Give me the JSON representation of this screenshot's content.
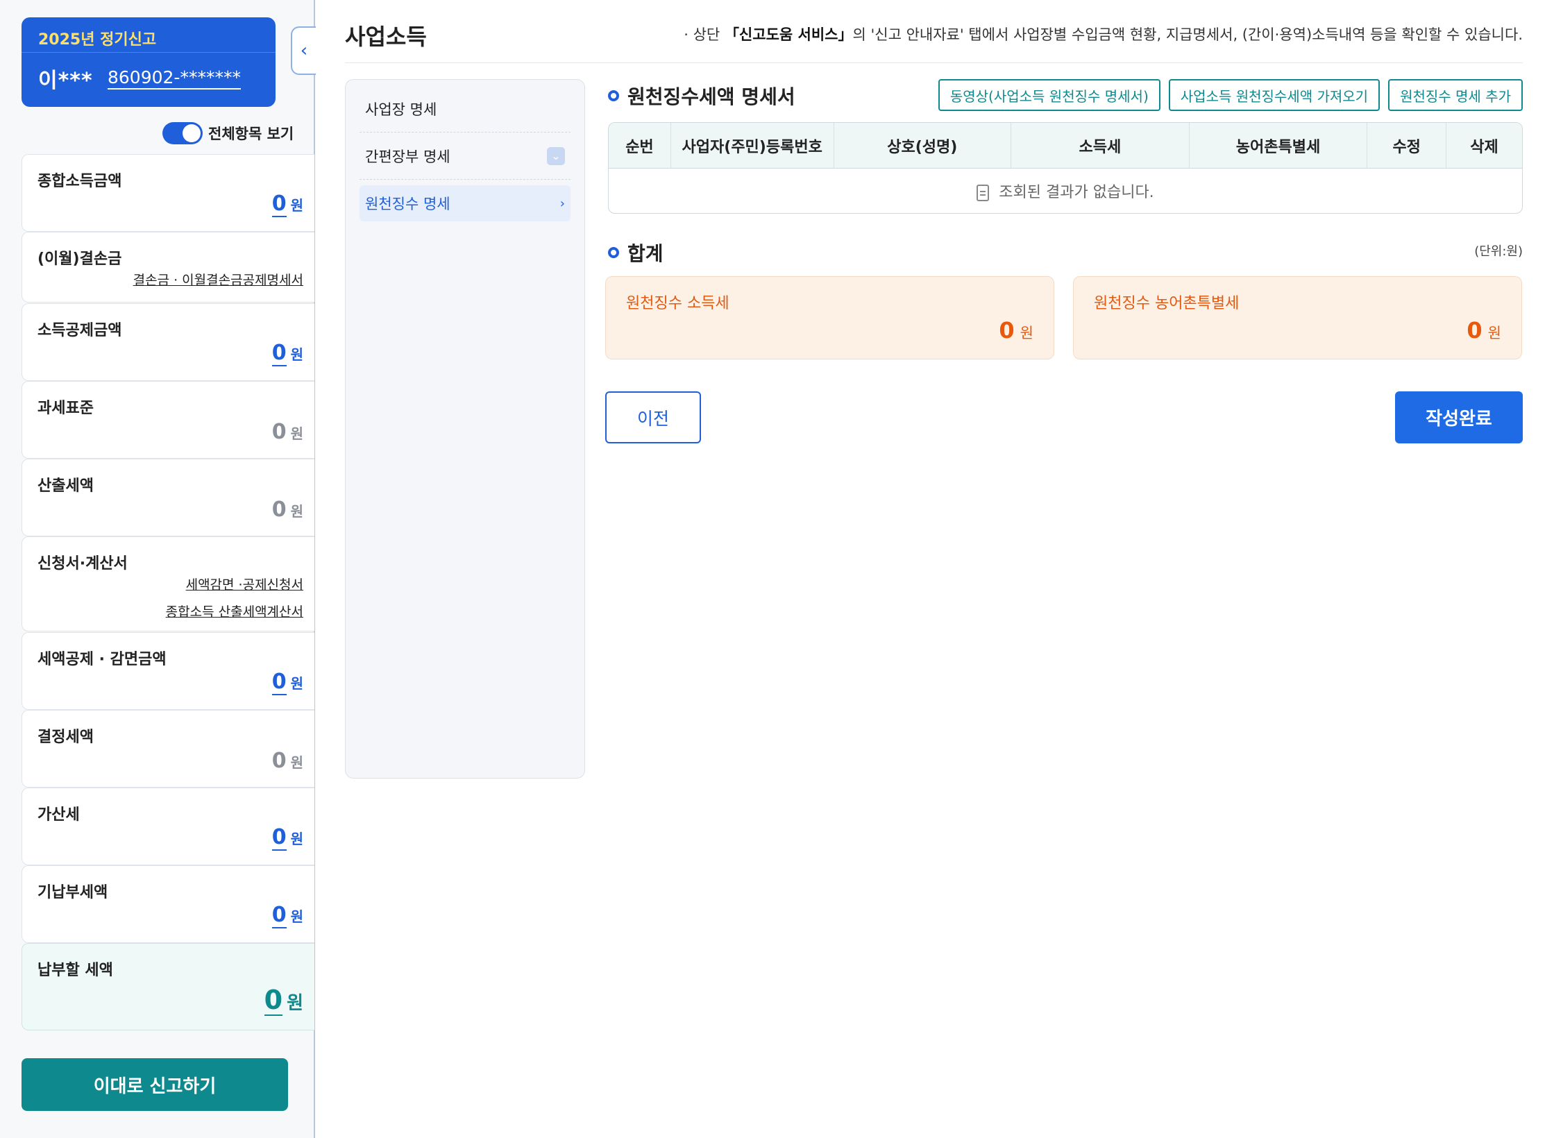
{
  "profile": {
    "year_badge": "2025년 정기신고",
    "name": "이***",
    "rrn": "860902-*******"
  },
  "toggle": {
    "label": "전체항목 보기",
    "on": true
  },
  "summary": {
    "total_income": {
      "label": "종합소득금액",
      "value": "0",
      "unit": "원"
    },
    "carryover_loss": {
      "label": "(이월)결손금",
      "link": "결손금 · 이월결손금공제명세서"
    },
    "income_deduction": {
      "label": "소득공제금액",
      "value": "0",
      "unit": "원"
    },
    "tax_base": {
      "label": "과세표준",
      "value": "0",
      "unit": "원"
    },
    "calculated_tax": {
      "label": "산출세액",
      "value": "0",
      "unit": "원"
    },
    "applications": {
      "label": "신청서·계산서",
      "link1": "세액감면 ·공제신청서",
      "link2": "종합소득 산출세액계산서"
    },
    "tax_credit": {
      "label": "세액공제 · 감면금액",
      "value": "0",
      "unit": "원"
    },
    "determined_tax": {
      "label": "결정세액",
      "value": "0",
      "unit": "원"
    },
    "penalty_tax": {
      "label": "가산세",
      "value": "0",
      "unit": "원"
    },
    "prepaid_tax": {
      "label": "기납부세액",
      "value": "0",
      "unit": "원"
    },
    "payable_tax": {
      "label": "납부할 세액",
      "value": "0",
      "unit": "원"
    }
  },
  "submit_button": "이대로 신고하기",
  "main": {
    "title": "사업소득",
    "notice_prefix": "상단 ",
    "notice_bold": "「신고도움 서비스」",
    "notice_suffix": "의 '신고 안내자료' 탭에서 사업장별 수입금액 현황, 지급명세서, (간이·용역)소득내역 등을 확인할 수 있습니다."
  },
  "submenu": [
    {
      "label": "사업장 명세"
    },
    {
      "label": "간편장부 명세"
    },
    {
      "label": "원천징수 명세"
    }
  ],
  "withholding": {
    "title": "원천징수세액 명세서",
    "buttons": [
      "동영상(사업소득 원천징수 명세서)",
      "사업소득 원천징수세액 가져오기",
      "원천징수 명세 추가"
    ],
    "columns": [
      "순번",
      "사업자(주민)등록번호",
      "상호(성명)",
      "소득세",
      "농어촌특별세",
      "수정",
      "삭제"
    ],
    "empty_message": "조회된 결과가 없습니다."
  },
  "totals": {
    "title": "합계",
    "unit_note": "(단위:원)",
    "income_tax": {
      "label": "원천징수 소득세",
      "value": "0",
      "unit": "원"
    },
    "rural_tax": {
      "label": "원천징수 농어촌특별세",
      "value": "0",
      "unit": "원"
    }
  },
  "nav": {
    "prev": "이전",
    "done": "작성완료"
  },
  "colors": {
    "primary": "#1f5fd9",
    "teal": "#0e8a8e",
    "orange": "#e8590c"
  }
}
